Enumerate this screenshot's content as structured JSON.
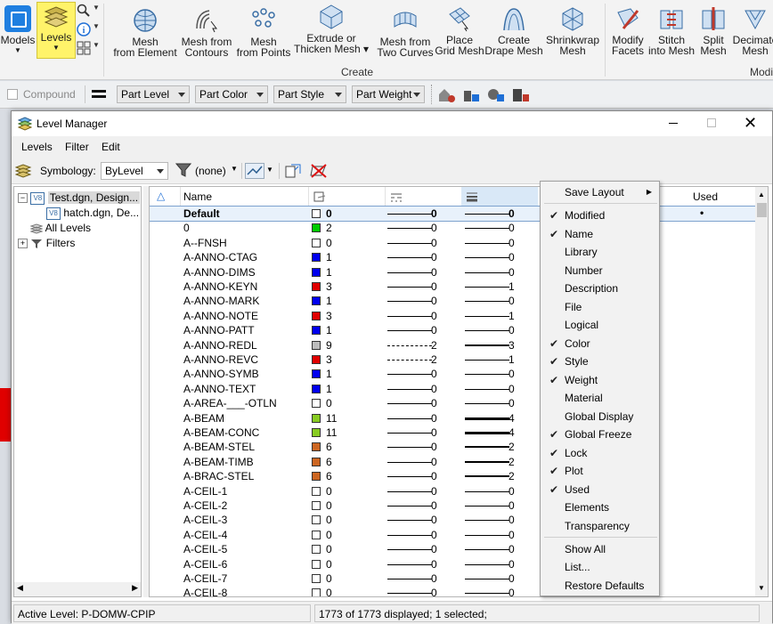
{
  "ribbon": {
    "models_label": "Models",
    "levels_label": "Levels",
    "tools": [
      {
        "line1": "Mesh",
        "line2": "from Element"
      },
      {
        "line1": "Mesh from",
        "line2": "Contours"
      },
      {
        "line1": "Mesh",
        "line2": "from Points"
      },
      {
        "line1": "Extrude or",
        "line2": "Thicken Mesh ▾"
      },
      {
        "line1": "Mesh from",
        "line2": "Two Curves"
      },
      {
        "line1": "Place",
        "line2": "Grid Mesh"
      },
      {
        "line1": "Create",
        "line2": "Drape Mesh"
      },
      {
        "line1": "Shrinkwrap",
        "line2": "Mesh"
      },
      {
        "line1": "Modify",
        "line2": "Facets"
      },
      {
        "line1": "Stitch",
        "line2": "into Mesh"
      },
      {
        "line1": "Split",
        "line2": "Mesh"
      },
      {
        "line1": "Decimate",
        "line2": "Mesh"
      }
    ],
    "group_create": "Create",
    "group_modify": "Modi"
  },
  "attrbar": {
    "compound": "Compound",
    "part_level": "Part Level",
    "part_color": "Part Color",
    "part_style": "Part Style",
    "part_weight": "Part Weight"
  },
  "dialog": {
    "title": "Level Manager",
    "menus": [
      "Levels",
      "Filter",
      "Edit"
    ],
    "symbology_label": "Symbology:",
    "symbology_value": "ByLevel",
    "filter_value": "(none)",
    "tree": [
      {
        "label": "Test.dgn, Design..."
      },
      {
        "label": "hatch.dgn, De..."
      },
      {
        "label": "All Levels"
      },
      {
        "label": "Filters"
      }
    ],
    "columns": {
      "name": "Name",
      "used": "Used"
    },
    "rows": [
      {
        "name": "Default",
        "color": "#ffffff",
        "cnum": "0",
        "style": "0",
        "weight": "0",
        "dashed": false,
        "w": 1,
        "used": "•",
        "selected": true
      },
      {
        "name": "0",
        "color": "#00cc00",
        "cnum": "2",
        "style": "0",
        "weight": "0",
        "dashed": false,
        "w": 1
      },
      {
        "name": "A--FNSH",
        "color": "#ffffff",
        "cnum": "0",
        "style": "0",
        "weight": "0",
        "dashed": false,
        "w": 1
      },
      {
        "name": "A-ANNO-CTAG",
        "color": "#0000ee",
        "cnum": "1",
        "style": "0",
        "weight": "0",
        "dashed": false,
        "w": 1
      },
      {
        "name": "A-ANNO-DIMS",
        "color": "#0000ee",
        "cnum": "1",
        "style": "0",
        "weight": "0",
        "dashed": false,
        "w": 1
      },
      {
        "name": "A-ANNO-KEYN",
        "color": "#e00000",
        "cnum": "3",
        "style": "0",
        "weight": "1",
        "dashed": false,
        "w": 1
      },
      {
        "name": "A-ANNO-MARK",
        "color": "#0000ee",
        "cnum": "1",
        "style": "0",
        "weight": "0",
        "dashed": false,
        "w": 1
      },
      {
        "name": "A-ANNO-NOTE",
        "color": "#e00000",
        "cnum": "3",
        "style": "0",
        "weight": "1",
        "dashed": false,
        "w": 1
      },
      {
        "name": "A-ANNO-PATT",
        "color": "#0000ee",
        "cnum": "1",
        "style": "0",
        "weight": "0",
        "dashed": false,
        "w": 1
      },
      {
        "name": "A-ANNO-REDL",
        "color": "#bdbdbd",
        "cnum": "9",
        "style": "2",
        "weight": "3",
        "dashed": true,
        "w": 2
      },
      {
        "name": "A-ANNO-REVC",
        "color": "#e00000",
        "cnum": "3",
        "style": "2",
        "weight": "1",
        "dashed": true,
        "w": 1
      },
      {
        "name": "A-ANNO-SYMB",
        "color": "#0000ee",
        "cnum": "1",
        "style": "0",
        "weight": "0",
        "dashed": false,
        "w": 1
      },
      {
        "name": "A-ANNO-TEXT",
        "color": "#0000ee",
        "cnum": "1",
        "style": "0",
        "weight": "0",
        "dashed": false,
        "w": 1
      },
      {
        "name": "A-AREA-___-OTLN",
        "color": "#ffffff",
        "cnum": "0",
        "style": "0",
        "weight": "0",
        "dashed": false,
        "w": 1
      },
      {
        "name": "A-BEAM",
        "color": "#88cc22",
        "cnum": "11",
        "style": "0",
        "weight": "4",
        "dashed": false,
        "w": 3
      },
      {
        "name": "A-BEAM-CONC",
        "color": "#88cc22",
        "cnum": "11",
        "style": "0",
        "weight": "4",
        "dashed": false,
        "w": 3
      },
      {
        "name": "A-BEAM-STEL",
        "color": "#cc6622",
        "cnum": "6",
        "style": "0",
        "weight": "2",
        "dashed": false,
        "w": 2
      },
      {
        "name": "A-BEAM-TIMB",
        "color": "#cc6622",
        "cnum": "6",
        "style": "0",
        "weight": "2",
        "dashed": false,
        "w": 2
      },
      {
        "name": "A-BRAC-STEL",
        "color": "#cc6622",
        "cnum": "6",
        "style": "0",
        "weight": "2",
        "dashed": false,
        "w": 2
      },
      {
        "name": "A-CEIL-1",
        "color": "#ffffff",
        "cnum": "0",
        "style": "0",
        "weight": "0",
        "dashed": false,
        "w": 1
      },
      {
        "name": "A-CEIL-2",
        "color": "#ffffff",
        "cnum": "0",
        "style": "0",
        "weight": "0",
        "dashed": false,
        "w": 1
      },
      {
        "name": "A-CEIL-3",
        "color": "#ffffff",
        "cnum": "0",
        "style": "0",
        "weight": "0",
        "dashed": false,
        "w": 1
      },
      {
        "name": "A-CEIL-4",
        "color": "#ffffff",
        "cnum": "0",
        "style": "0",
        "weight": "0",
        "dashed": false,
        "w": 1
      },
      {
        "name": "A-CEIL-5",
        "color": "#ffffff",
        "cnum": "0",
        "style": "0",
        "weight": "0",
        "dashed": false,
        "w": 1
      },
      {
        "name": "A-CEIL-6",
        "color": "#ffffff",
        "cnum": "0",
        "style": "0",
        "weight": "0",
        "dashed": false,
        "w": 1
      },
      {
        "name": "A-CEIL-7",
        "color": "#ffffff",
        "cnum": "0",
        "style": "0",
        "weight": "0",
        "dashed": false,
        "w": 1
      },
      {
        "name": "A-CEIL-8",
        "color": "#ffffff",
        "cnum": "0",
        "style": "0",
        "weight": "0",
        "dashed": false,
        "w": 1
      }
    ],
    "status_active": "Active Level: P-DOMW-CPIP",
    "status_count": "1773 of 1773 displayed; 1 selected;"
  },
  "context_menu": {
    "items": [
      {
        "label": "Save Layout",
        "checked": false,
        "submenu": true
      },
      {
        "label": "Modified",
        "checked": true
      },
      {
        "label": "Name",
        "checked": true
      },
      {
        "label": "Library",
        "checked": false
      },
      {
        "label": "Number",
        "checked": false
      },
      {
        "label": "Description",
        "checked": false
      },
      {
        "label": "File",
        "checked": false
      },
      {
        "label": "Logical",
        "checked": false
      },
      {
        "label": "Color",
        "checked": true
      },
      {
        "label": "Style",
        "checked": true
      },
      {
        "label": "Weight",
        "checked": true
      },
      {
        "label": "Material",
        "checked": false
      },
      {
        "label": "Global Display",
        "checked": false
      },
      {
        "label": "Global Freeze",
        "checked": true
      },
      {
        "label": "Lock",
        "checked": true
      },
      {
        "label": "Plot",
        "checked": true
      },
      {
        "label": "Used",
        "checked": true
      },
      {
        "label": "Elements",
        "checked": false
      },
      {
        "label": "Transparency",
        "checked": false
      },
      {
        "label": "Show All",
        "checked": false
      },
      {
        "label": "List...",
        "checked": false
      },
      {
        "label": "Restore Defaults",
        "checked": false
      }
    ]
  },
  "colors": {
    "accent": "#1f6fd6",
    "highlight": "#fff36a"
  }
}
